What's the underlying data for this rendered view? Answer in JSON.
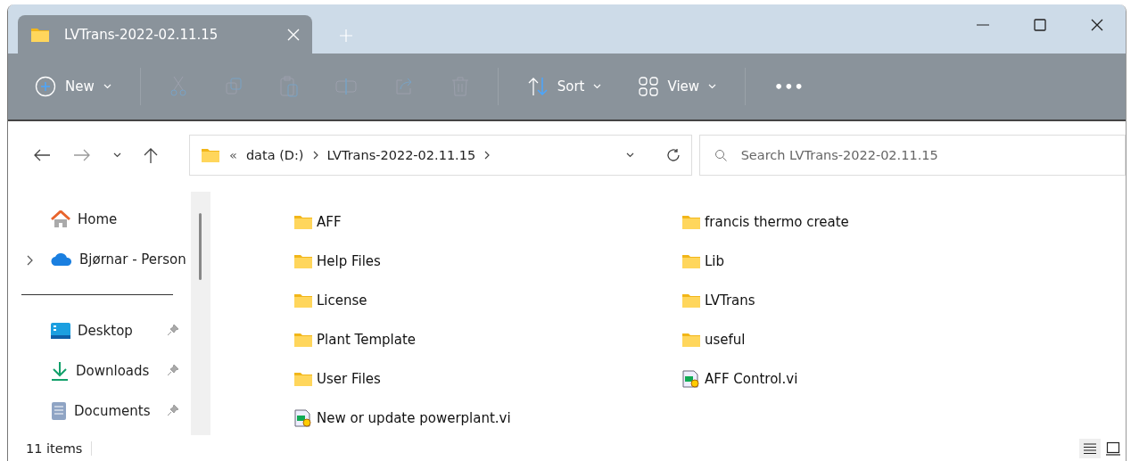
{
  "window": {
    "tab_title": "LVTrans-2022-02.11.15"
  },
  "toolbar": [
    {
      "kind": "new",
      "label": "New",
      "disabled": false
    },
    {
      "kind": "cut",
      "disabled": true
    },
    {
      "kind": "copy",
      "disabled": true
    },
    {
      "kind": "paste",
      "disabled": true
    },
    {
      "kind": "rename",
      "disabled": true
    },
    {
      "kind": "share",
      "disabled": true
    },
    {
      "kind": "delete",
      "disabled": true
    },
    {
      "kind": "sort",
      "label": "Sort",
      "disabled": false
    },
    {
      "kind": "view",
      "label": "View",
      "disabled": false
    },
    {
      "kind": "more",
      "label": "•••",
      "disabled": false
    }
  ],
  "address": {
    "overflow": "«",
    "crumbs": [
      "data (D:)",
      "LVTrans-2022-02.11.15"
    ]
  },
  "search": {
    "placeholder": "Search LVTrans-2022-02.11.15"
  },
  "sidebar": {
    "items": [
      {
        "kind": "home",
        "label": "Home",
        "pinned": false
      },
      {
        "kind": "cloud",
        "label": "Bjørnar - Person",
        "pinned": false,
        "expanded": false
      },
      {
        "kind": "separator"
      },
      {
        "kind": "desktop",
        "label": "Desktop",
        "pinned": true
      },
      {
        "kind": "downloads",
        "label": "Downloads",
        "pinned": true
      },
      {
        "kind": "documents",
        "label": "Documents",
        "pinned": true
      }
    ]
  },
  "files": [
    {
      "kind": "folder",
      "name": "AFF"
    },
    {
      "kind": "folder",
      "name": "francis thermo create"
    },
    {
      "kind": "folder",
      "name": "Help Files"
    },
    {
      "kind": "folder",
      "name": "Lib"
    },
    {
      "kind": "folder",
      "name": "License"
    },
    {
      "kind": "folder",
      "name": "LVTrans"
    },
    {
      "kind": "folder",
      "name": "Plant Template"
    },
    {
      "kind": "folder",
      "name": "useful"
    },
    {
      "kind": "folder",
      "name": "User Files"
    },
    {
      "kind": "vi",
      "name": "AFF Control.vi"
    },
    {
      "kind": "vi",
      "name": "New or update powerplant.vi"
    }
  ],
  "status_bar": {
    "count": "11 items",
    "views": [
      {
        "kind": "details",
        "selected": true
      },
      {
        "kind": "tiles",
        "selected": false
      }
    ]
  }
}
